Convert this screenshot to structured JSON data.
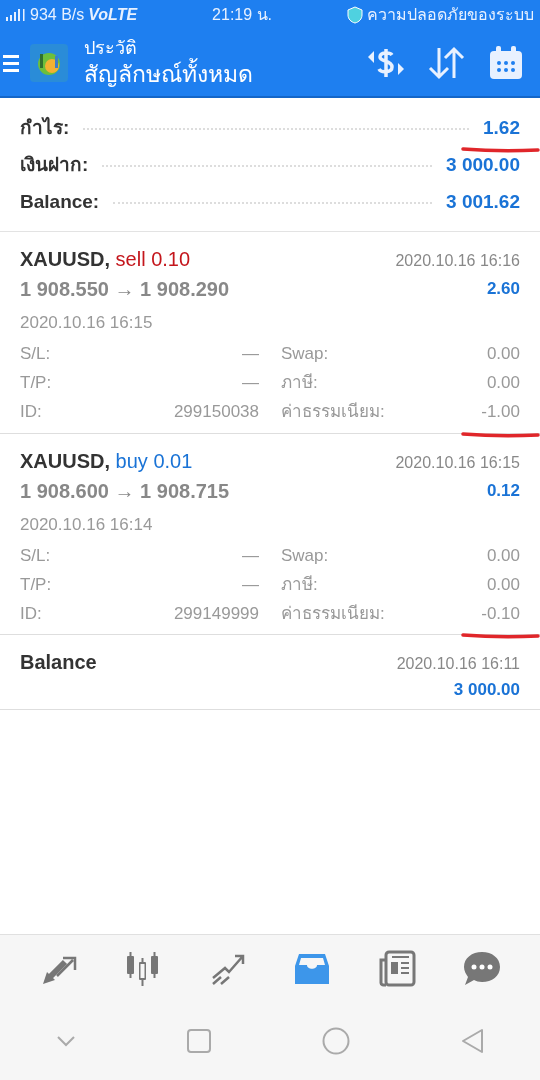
{
  "status_bar": {
    "speed": "934 B/s",
    "network": "VoLTE",
    "time": "21:19 น.",
    "security": "ความปลอดภัยของระบบ"
  },
  "header": {
    "subtitle": "ประวัติ",
    "title": "สัญลักษณ์ทั้งหมด"
  },
  "summary": [
    {
      "label": "กำไร:",
      "value": "1.62"
    },
    {
      "label": "เงินฝาก:",
      "value": "3 000.00"
    },
    {
      "label": "Balance:",
      "value": "3 001.62"
    }
  ],
  "deals": [
    {
      "kind": "trade",
      "symbol": "XAUUSD,",
      "color": "#c4161c",
      "order": "sell 0.10",
      "close_time": "2020.10.16 16:16",
      "prices": "1 908.550 → 1 908.290",
      "profit": "2.60",
      "open_time": "2020.10.16 16:15",
      "fields": [
        {
          "label": "S/L:",
          "value": "—",
          "label2": "Swap:",
          "value2": "0.00"
        },
        {
          "label": "T/P:",
          "value": "—",
          "label2": "ภาษี:",
          "value2": "0.00"
        },
        {
          "label": "ID:",
          "value": "299150038",
          "label2": "ค่าธรรมเนียม:",
          "value2": "-1.00"
        }
      ]
    },
    {
      "kind": "trade",
      "symbol": "XAUUSD,",
      "color": "#1a73d6",
      "order": "buy 0.01",
      "close_time": "2020.10.16 16:15",
      "prices": "1 908.600 → 1 908.715",
      "profit": "0.12",
      "open_time": "2020.10.16 16:14",
      "fields": [
        {
          "label": "S/L:",
          "value": "—",
          "label2": "Swap:",
          "value2": "0.00"
        },
        {
          "label": "T/P:",
          "value": "—",
          "label2": "ภาษี:",
          "value2": "0.00"
        },
        {
          "label": "ID:",
          "value": "299149999",
          "label2": "ค่าธรรมเนียม:",
          "value2": "-0.10"
        }
      ]
    },
    {
      "kind": "balance",
      "label": "Balance",
      "time": "2020.10.16 16:11",
      "amount": "3 000.00"
    }
  ],
  "bottom_nav": [
    {
      "kind": "trade",
      "selected": false
    },
    {
      "kind": "quotes",
      "selected": false
    },
    {
      "kind": "chart",
      "selected": false
    },
    {
      "kind": "history",
      "selected": true
    },
    {
      "kind": "news",
      "selected": false
    },
    {
      "kind": "chat",
      "selected": false
    }
  ]
}
